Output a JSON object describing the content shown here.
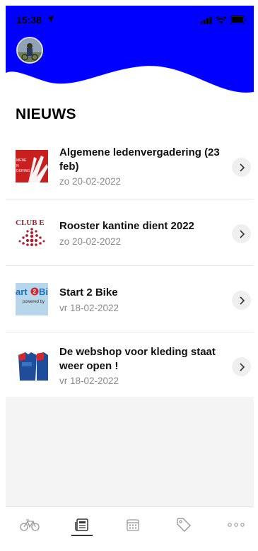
{
  "status_bar": {
    "time": "15:38"
  },
  "page": {
    "title": "NIEUWS"
  },
  "news": [
    {
      "title": "Algemene ledenvergadering (23 feb)",
      "date": "zo 20-02-2022",
      "thumb_text": [
        "MENE",
        "N",
        "DERING"
      ]
    },
    {
      "title": "Rooster kantine dient 2022",
      "date": "zo 20-02-2022",
      "thumb_text": "CLUB E"
    },
    {
      "title": "Start 2 Bike",
      "date": "vr 18-02-2022",
      "thumb_text": [
        "art",
        "2",
        "Bi",
        "powered by"
      ]
    },
    {
      "title": "De webshop voor kleding staat weer open !",
      "date": "vr 18-02-2022"
    }
  ],
  "tabs": [
    {
      "icon": "bicycle-icon",
      "active": false
    },
    {
      "icon": "newspaper-icon",
      "active": true
    },
    {
      "icon": "calendar-icon",
      "active": false
    },
    {
      "icon": "tag-icon",
      "active": false
    },
    {
      "icon": "more-dots-icon",
      "active": false
    }
  ],
  "colors": {
    "header_blue": "#0000ff",
    "accent_red": "#c8201f",
    "empty_bg": "#f4f4f4"
  }
}
